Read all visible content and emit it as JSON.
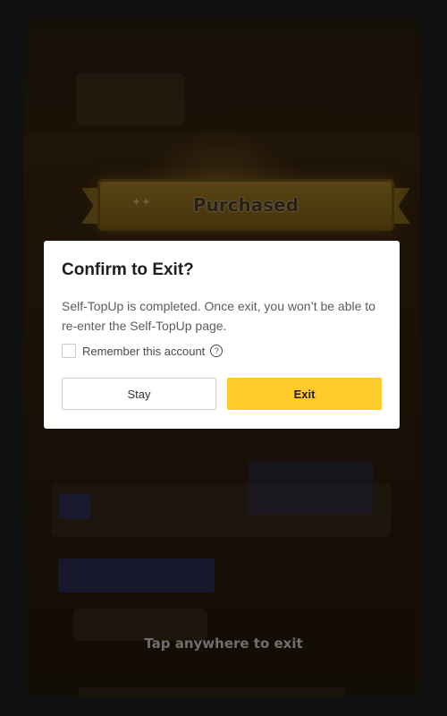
{
  "background": {
    "banner_label": "Purchased",
    "tap_hint": "Tap anywhere to exit"
  },
  "dialog": {
    "title": "Confirm to Exit?",
    "body": "Self-TopUp is completed. Once exit, you won’t be able to re-enter the Self-TopUp page.",
    "remember_label": "Remember this account",
    "remember_checked": false,
    "help_icon": "question-circle-icon",
    "stay_label": "Stay",
    "exit_label": "Exit"
  },
  "colors": {
    "accent": "#ffca2a",
    "dialog_bg": "#ffffff",
    "overlay": "#1a1a1a"
  }
}
